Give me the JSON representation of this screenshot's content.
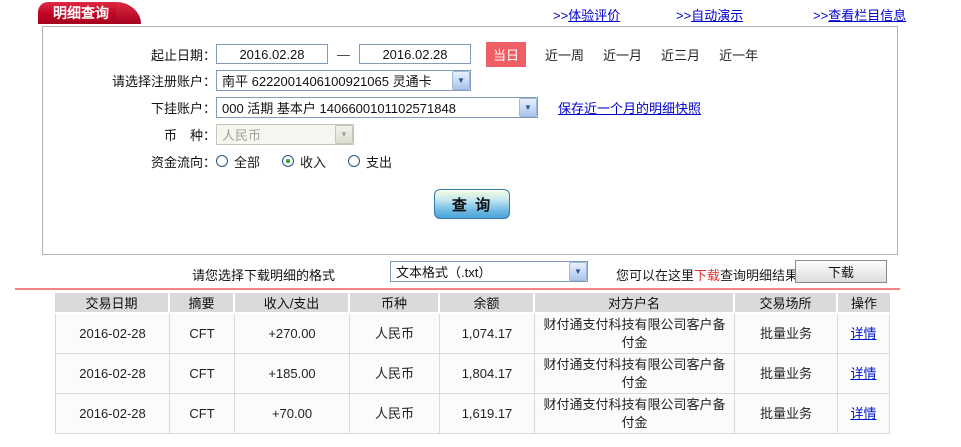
{
  "colors": {
    "tab_red": "#c00424",
    "highlight_red": "#ef5e64",
    "link_blue": "#0000cc",
    "amount_red": "#cc0000",
    "table_header_grey": "#dadada"
  },
  "header": {
    "tab_title": "明细查询",
    "links": [
      {
        "prefix": ">>",
        "label": "体验评价"
      },
      {
        "prefix": ">>",
        "label": "自动演示"
      },
      {
        "prefix": ">>",
        "label": "查看栏目信息"
      }
    ]
  },
  "form": {
    "date_label": "起止日期：",
    "date_from": "2016.02.28",
    "dash": "—",
    "date_to": "2016.02.28",
    "quick_ranges": [
      {
        "label": "当日",
        "active": true
      },
      {
        "label": "近一周",
        "active": false
      },
      {
        "label": "近一月",
        "active": false
      },
      {
        "label": "近三月",
        "active": false
      },
      {
        "label": "近一年",
        "active": false
      }
    ],
    "register_account_label": "请选择注册账户：",
    "register_account_value": "南平 6222001406100921065 灵通卡",
    "sub_account_label": "下挂账户：",
    "sub_account_value": "000 活期 基本户 1406600101102571848",
    "snapshot_link": "保存近一个月的明细快照",
    "currency_label": "币　种：",
    "currency_value": "人民币",
    "flow_label": "资金流向：",
    "flow_options": [
      {
        "label": "全部",
        "selected": false
      },
      {
        "label": "收入",
        "selected": true
      },
      {
        "label": "支出",
        "selected": false
      }
    ],
    "query_button": "查 询",
    "dropdown_arrow": "▼"
  },
  "download": {
    "format_label": "请您选择下载明细的格式",
    "format_value": "文本格式（.txt）",
    "hint_before": "您可以在这里",
    "hint_red": "下载",
    "hint_after": "查询明细结果",
    "button_label": "下载"
  },
  "table": {
    "headers": [
      "交易日期",
      "摘要",
      "收入/支出",
      "币种",
      "余额",
      "对方户名",
      "交易场所",
      "操作"
    ],
    "rows": [
      {
        "date": "2016-02-28",
        "summary": "CFT",
        "amount": "+270.00",
        "currency": "人民币",
        "balance": "1,074.17",
        "counterparty": "财付通支付科技有限公司客户备付金",
        "place": "批量业务",
        "action": "详情"
      },
      {
        "date": "2016-02-28",
        "summary": "CFT",
        "amount": "+185.00",
        "currency": "人民币",
        "balance": "1,804.17",
        "counterparty": "财付通支付科技有限公司客户备付金",
        "place": "批量业务",
        "action": "详情"
      },
      {
        "date": "2016-02-28",
        "summary": "CFT",
        "amount": "+70.00",
        "currency": "人民币",
        "balance": "1,619.17",
        "counterparty": "财付通支付科技有限公司客户备付金",
        "place": "批量业务",
        "action": "详情"
      }
    ]
  }
}
